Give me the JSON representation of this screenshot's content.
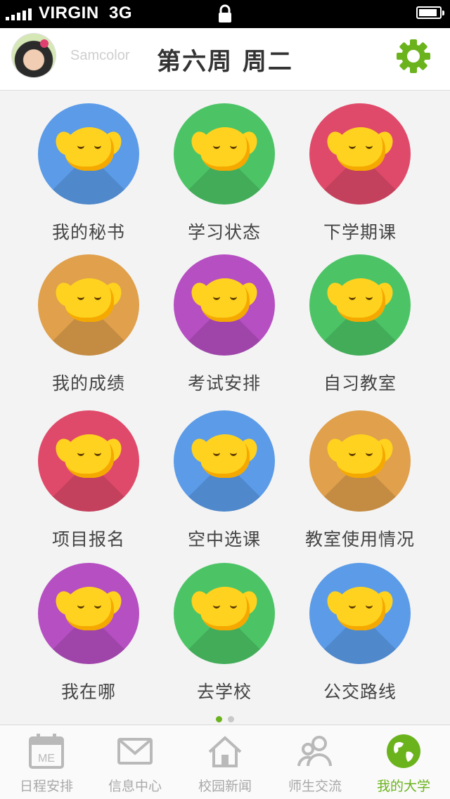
{
  "status_bar": {
    "carrier": "VIRGIN",
    "network": "3G",
    "signal_icon": "signal-bars-icon",
    "lock_icon": "lock-icon",
    "battery_icon": "battery-icon",
    "battery_level": 0.9
  },
  "header": {
    "username": "Samcolor",
    "title": "第六周 周二",
    "settings_icon": "gear-icon",
    "accent": "#6bb31d"
  },
  "apps": [
    {
      "label": "我的秘书",
      "color": "#5b9be8",
      "icon": "mascot-secretary-icon"
    },
    {
      "label": "学习状态",
      "color": "#4cc466",
      "icon": "mascot-heart-icon"
    },
    {
      "label": "下学期课",
      "color": "#e04a6a",
      "icon": "mascot-next-semester-icon"
    },
    {
      "label": "我的成绩",
      "color": "#e0a04c",
      "icon": "mascot-grades-icon"
    },
    {
      "label": "考试安排",
      "color": "#b64fc2",
      "icon": "mascot-examination-icon"
    },
    {
      "label": "自习教室",
      "color": "#4cc466",
      "icon": "mascot-study-room-icon"
    },
    {
      "label": "项目报名",
      "color": "#e04a6a",
      "icon": "mascot-headset-icon"
    },
    {
      "label": "空中选课",
      "color": "#5b9be8",
      "icon": "mascot-airplane-icon"
    },
    {
      "label": "教室使用情况",
      "color": "#e0a04c",
      "icon": "mascot-books-icon"
    },
    {
      "label": "我在哪",
      "color": "#b64fc2",
      "icon": "mascot-location-icon"
    },
    {
      "label": "去学校",
      "color": "#4cc466",
      "icon": "mascot-car-icon"
    },
    {
      "label": "公交路线",
      "color": "#5b9be8",
      "icon": "mascot-bus-icon"
    }
  ],
  "page_indicator": {
    "count": 2,
    "active": 0,
    "active_color": "#6bb31d",
    "inactive_color": "#c8c8c8"
  },
  "tabs": [
    {
      "label": "日程安排",
      "icon": "calendar-icon",
      "icon_text": "ME",
      "active": false
    },
    {
      "label": "信息中心",
      "icon": "envelope-icon",
      "active": false
    },
    {
      "label": "校园新闻",
      "icon": "house-icon",
      "active": false
    },
    {
      "label": "师生交流",
      "icon": "people-icon",
      "active": false
    },
    {
      "label": "我的大学",
      "icon": "globe-icon",
      "active": true
    }
  ]
}
